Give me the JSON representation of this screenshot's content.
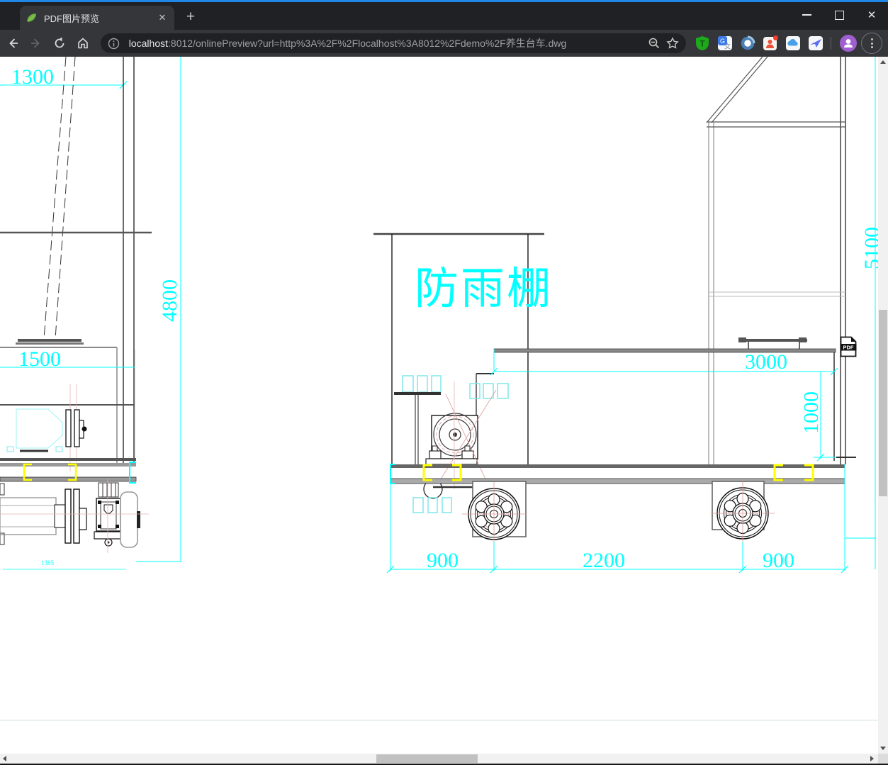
{
  "window": {
    "title": "PDF图片预览",
    "controls": {
      "close_glyph": "✕"
    }
  },
  "tab": {
    "title": "PDF图片预览",
    "favicon": "spring-leaf-icon",
    "close_glyph": "✕",
    "new_tab_glyph": "+"
  },
  "toolbar": {
    "icons": [
      "back-icon",
      "forward-icon",
      "reload-icon",
      "home-icon",
      "info-icon",
      "zoom-icon",
      "bookmark-star-icon"
    ],
    "url_host": "localhost",
    "url_rest": ":8012/onlinePreview?url=http%3A%2F%2Flocalhost%3A8012%2Fdemo%2F养生台车.dwg"
  },
  "extensions": {
    "items": [
      "tampermonkey-icon",
      "translate-icon",
      "ring-icon",
      "helper-icon",
      "cloud-icon",
      "bird-icon"
    ],
    "tampermonkey_letter": "T"
  },
  "drawing": {
    "labels": {
      "dim_1300": "1300",
      "dim_4800": "4800",
      "dim_1500": "1500",
      "dim_1385": "1385",
      "shelter_text": "防雨棚",
      "dim_3000": "3000",
      "dim_1000": "1000",
      "dim_5100": "5100",
      "dim_900_left": "900",
      "dim_2200": "2200",
      "dim_900_right": "900"
    },
    "colors": {
      "dimension": "#00ffff",
      "dimension_light": "#7fe8e8",
      "highlight": "#ffff00",
      "centerline": "#dd9a9a",
      "line_dark": "#1a1a1a",
      "line_gray": "#888888"
    }
  },
  "pdf_badge": {
    "label": "PDF"
  }
}
